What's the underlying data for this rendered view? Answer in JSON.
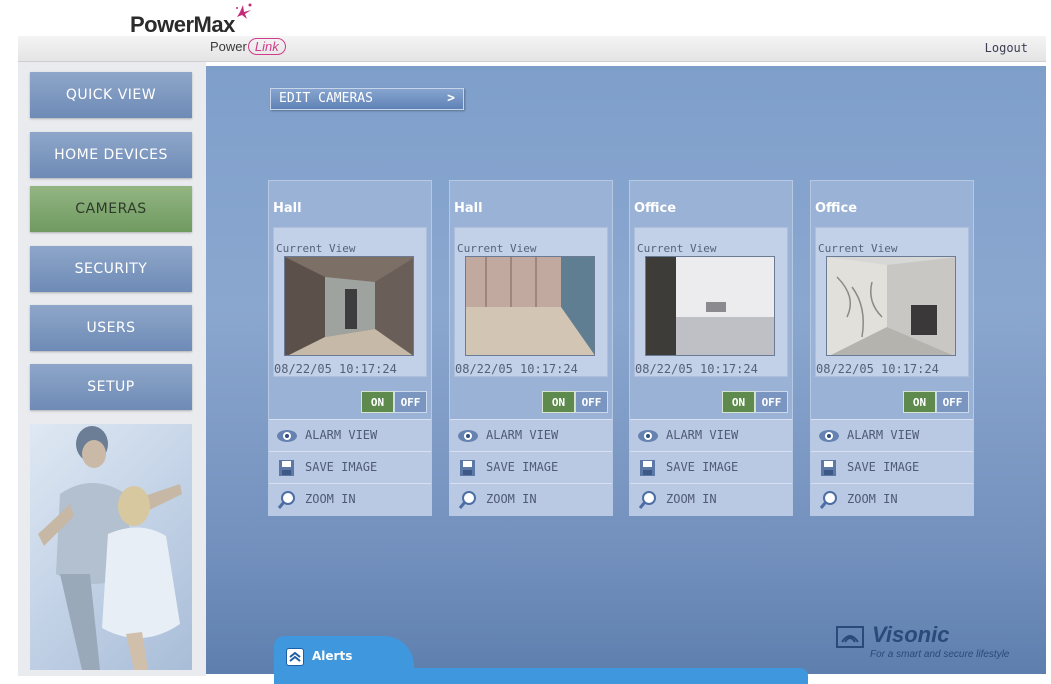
{
  "brand": {
    "logo": "PowerMax",
    "sub_logo_prefix": "Power",
    "sub_logo_suffix": "Link"
  },
  "header": {
    "logout": "Logout"
  },
  "sidebar": {
    "items": [
      {
        "label": "QUICK VIEW",
        "active": false
      },
      {
        "label": "HOME DEVICES",
        "active": false
      },
      {
        "label": "CAMERAS",
        "active": true
      },
      {
        "label": "SECURITY",
        "active": false
      },
      {
        "label": "USERS",
        "active": false
      },
      {
        "label": "SETUP",
        "active": false
      }
    ]
  },
  "main": {
    "edit_cameras": "EDIT CAMERAS",
    "cameras": [
      {
        "name": "Hall",
        "current_view": "Current View",
        "timestamp": "08/22/05  10:17:24",
        "on": "ON",
        "off": "OFF"
      },
      {
        "name": "Hall",
        "current_view": "Current View",
        "timestamp": "08/22/05  10:17:24",
        "on": "ON",
        "off": "OFF"
      },
      {
        "name": "Office",
        "current_view": "Current View",
        "timestamp": "08/22/05  10:17:24",
        "on": "ON",
        "off": "OFF"
      },
      {
        "name": "Office",
        "current_view": "Current View",
        "timestamp": "08/22/05  10:17:24",
        "on": "ON",
        "off": "OFF"
      }
    ],
    "actions": {
      "alarm_view": "ALARM VIEW",
      "save_image": "SAVE IMAGE",
      "zoom_in": "ZOOM IN"
    }
  },
  "alerts": {
    "label": "Alerts"
  },
  "footer": {
    "brand": "Visonic",
    "tagline": "For a smart and secure lifestyle"
  },
  "colors": {
    "active_nav": "#7aa26a",
    "nav": "#7d98c1",
    "panel": "#7f9fcb",
    "alerts": "#3f97dd"
  }
}
